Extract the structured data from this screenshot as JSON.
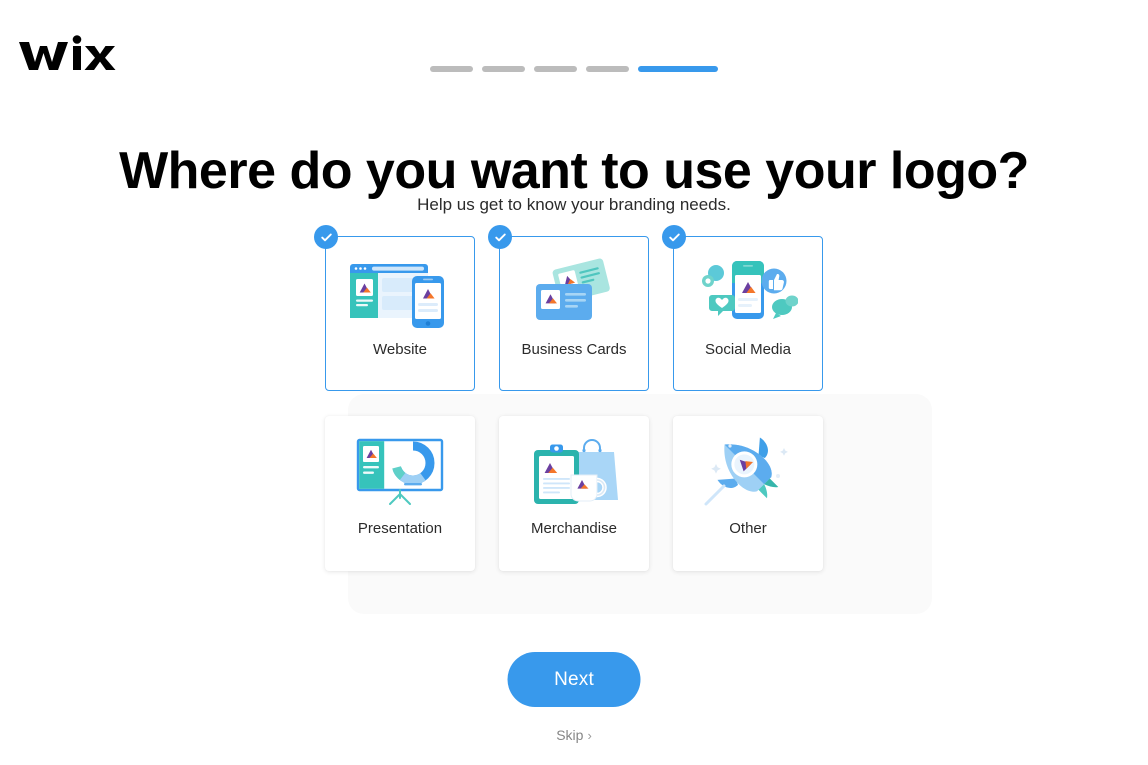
{
  "brand": {
    "name": "Wix",
    "logo_icon": "wix-logo"
  },
  "progress": {
    "total_steps": 5,
    "current_step": 5,
    "segments": [
      "done",
      "done",
      "done",
      "done",
      "active"
    ],
    "active_color": "#3899ec",
    "inactive_color": "#bcbcbc"
  },
  "header": {
    "title": "Where do you want to use your logo?",
    "subtitle": "Help us get to know your branding needs."
  },
  "options": [
    {
      "id": "website",
      "label": "Website",
      "selected": true,
      "icon": "website-illustration"
    },
    {
      "id": "business-cards",
      "label": "Business Cards",
      "selected": true,
      "icon": "business-cards-illustration"
    },
    {
      "id": "social-media",
      "label": "Social Media",
      "selected": true,
      "icon": "social-media-illustration"
    },
    {
      "id": "presentation",
      "label": "Presentation",
      "selected": false,
      "icon": "presentation-illustration"
    },
    {
      "id": "merchandise",
      "label": "Merchandise",
      "selected": false,
      "icon": "merchandise-illustration"
    },
    {
      "id": "other",
      "label": "Other",
      "selected": false,
      "icon": "rocket-illustration"
    }
  ],
  "footer": {
    "next_label": "Next",
    "skip_label": "Skip",
    "skip_chevron": "›"
  },
  "colors": {
    "brand_blue": "#3899ec",
    "teal": "#2bb3ad",
    "light_blue": "#a9d6f7",
    "text_dark": "#2b2b2b",
    "text_muted": "#868686",
    "logo_purple": "#6b3fa0",
    "logo_orange": "#f4762a"
  }
}
